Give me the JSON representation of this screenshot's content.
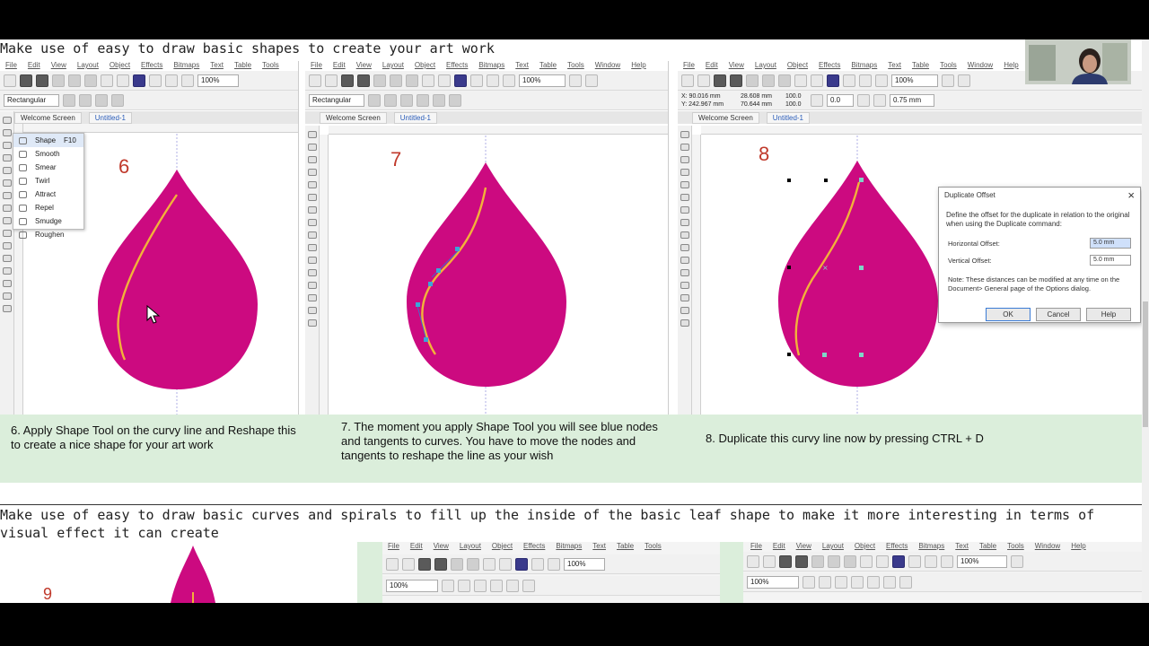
{
  "top_heading": "Make use of easy to draw basic shapes to create your art work",
  "bottom_heading": "Make use of easy to draw basic curves and spirals to fill up the inside of the basic leaf shape to make it more interesting in terms of visual effect it can create",
  "menu_items": [
    "File",
    "Edit",
    "View",
    "Layout",
    "Object",
    "Effects",
    "Bitmaps",
    "Text",
    "Table",
    "Tools",
    "Window",
    "Help"
  ],
  "zoom_value": "100%",
  "shape_selector": "Rectangular",
  "tabs": {
    "welcome": "Welcome Screen",
    "doc": "Untitled-1"
  },
  "colors": {
    "drop": "#cc0a80",
    "curve": "#f2b23a",
    "caption_bg": "#dbeedb",
    "step_number": "#c0392b"
  },
  "panels": [
    {
      "step": "6",
      "caption": "6. Apply Shape Tool on the curvy line and Reshape this to create a nice shape for your art work"
    },
    {
      "step": "7",
      "caption": "7. The moment you apply Shape Tool you will see blue nodes and tangents to curves. You have to move the nodes and tangents to reshape the line as your wish"
    },
    {
      "step": "8",
      "caption": "8. Duplicate this curvy line now by pressing CTRL + D"
    }
  ],
  "shape_flyout": {
    "header": "Shape",
    "shortcut": "F10",
    "items": [
      "Smooth",
      "Smear",
      "Twirl",
      "Attract",
      "Repel",
      "Smudge",
      "Roughen"
    ]
  },
  "property_bar_8": {
    "x": "X: 90.016 mm",
    "y": "Y: 242.967 mm",
    "w": "28.608 mm",
    "h": "70.644 mm",
    "sx": "100.0",
    "sy": "100.0",
    "angle": "0.0",
    "outline": "0.75 mm"
  },
  "duplicate_dialog": {
    "title": "Duplicate Offset",
    "description": "Define the offset for the duplicate in relation to the original when using the Duplicate command:",
    "horizontal_label": "Horizontal Offset:",
    "horizontal_value": "5.0 mm",
    "vertical_label": "Vertical Offset:",
    "vertical_value": "5.0 mm",
    "note": "Note: These distances can be modified at any time on the Document> General page of the Options dialog.",
    "ok": "OK",
    "cancel": "Cancel",
    "help": "Help"
  },
  "step_9": "9"
}
